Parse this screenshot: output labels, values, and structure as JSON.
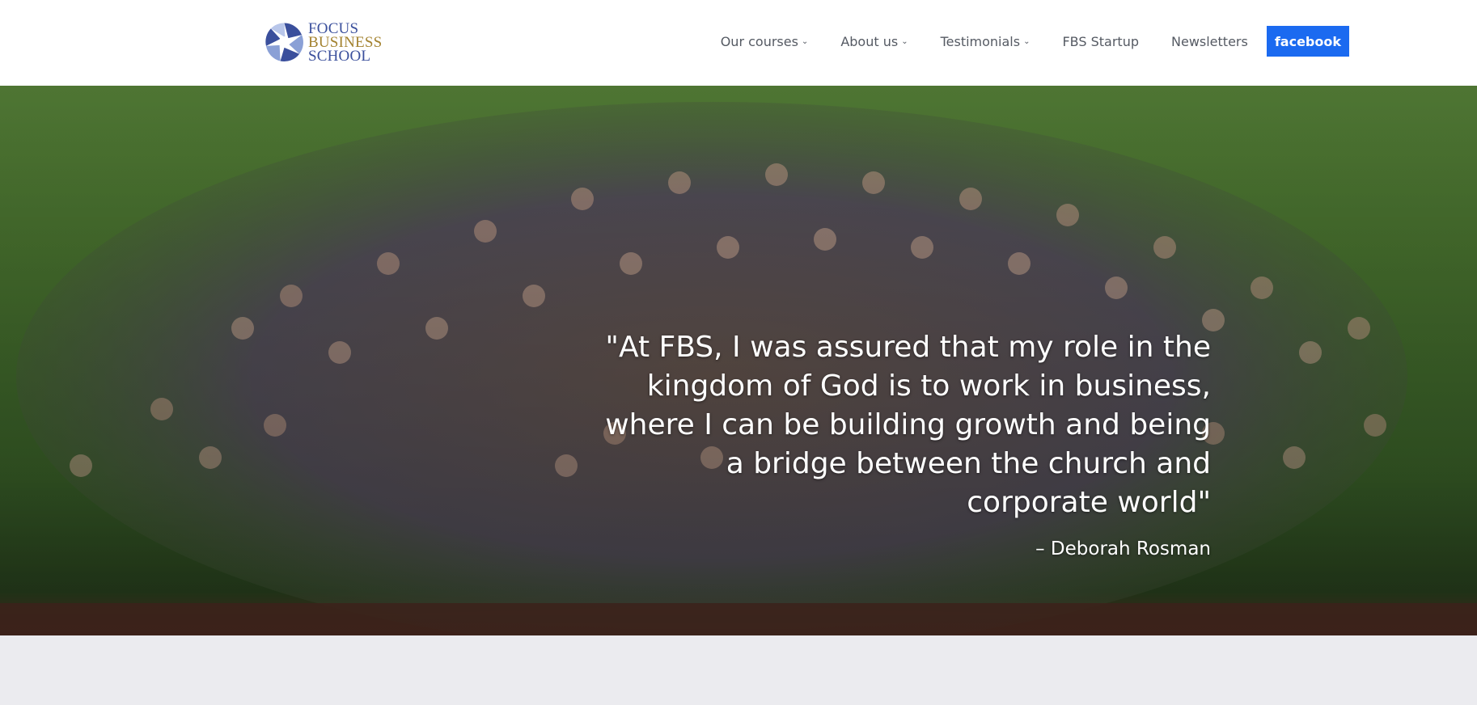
{
  "logo": {
    "line1": "FOCUS",
    "line2": "BUSINESS",
    "line3": "SCHOOL",
    "colors": {
      "blue": "#3a4f9c",
      "gold": "#a3822f"
    }
  },
  "nav": {
    "items": [
      {
        "label": "Our courses",
        "dropdown": true
      },
      {
        "label": "About us",
        "dropdown": true
      },
      {
        "label": "Testimonials",
        "dropdown": true
      },
      {
        "label": "FBS Startup",
        "dropdown": false
      },
      {
        "label": "Newsletters",
        "dropdown": false
      }
    ],
    "dropdown_icon": "chevron-down-icon",
    "facebook_label": "facebook",
    "facebook_color": "#1b6af0"
  },
  "hero": {
    "quote": "\"At FBS, I was assured that my role in the kingdom of God is to work in business, where I can be building growth and being a bridge between the church and corporate world\"",
    "author": "– Deborah Rosman"
  }
}
